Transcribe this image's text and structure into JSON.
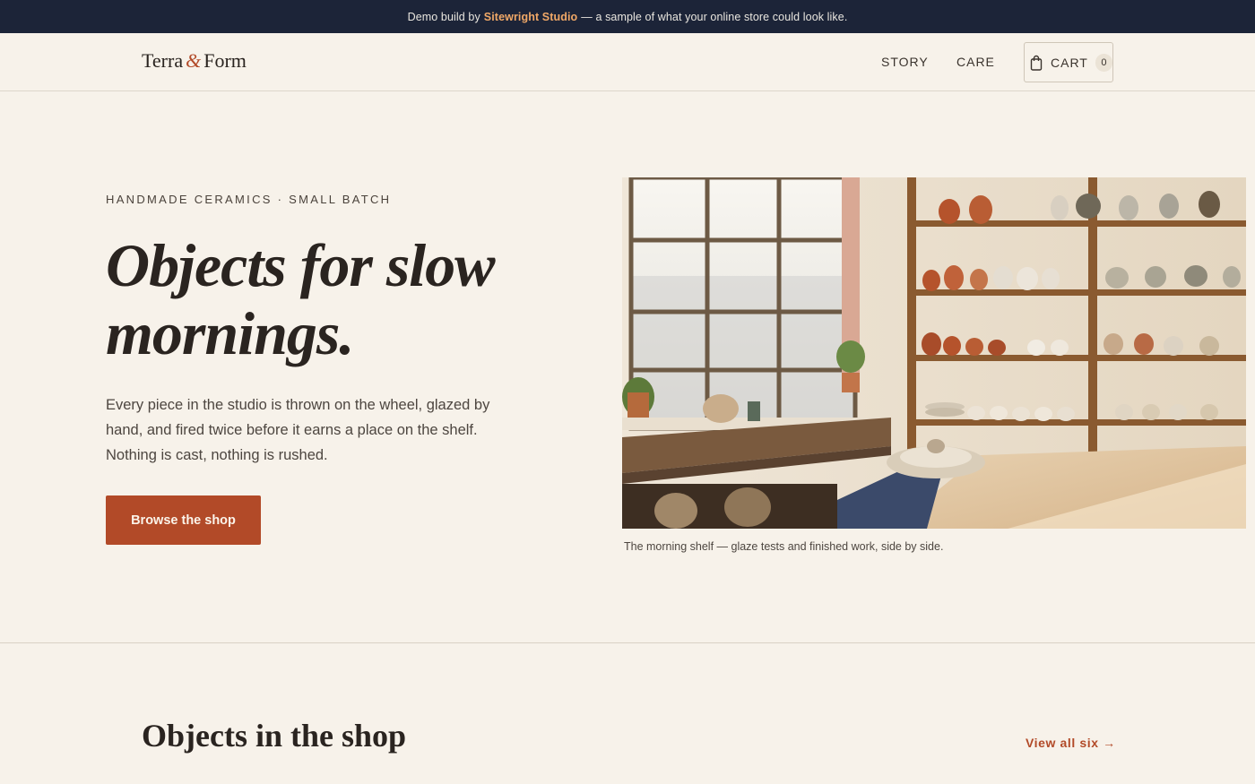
{
  "announcement": {
    "prefix": "Demo build by",
    "brand": "Sitewright Studio",
    "suffix": "— a sample of what your online store could look like."
  },
  "header": {
    "logo_left": "Terra",
    "logo_amp": "&",
    "logo_right": "Form",
    "nav": [
      {
        "label": "STORY"
      },
      {
        "label": "CARE"
      }
    ],
    "cart": {
      "label": "CART",
      "count": "0",
      "icon": "shopping-bag-icon"
    }
  },
  "hero": {
    "eyebrow": "HANDMADE CERAMICS · SMALL BATCH",
    "title": "Objects for slow mornings.",
    "body": "Every piece in the studio is thrown on the wheel, glazed by hand, and fired twice before it earns a place on the shelf. Nothing is cast, nothing is rushed.",
    "cta_label": "Browse the shop",
    "image_caption": "The morning shelf — glaze tests and finished work, side by side."
  },
  "shop": {
    "title": "Objects in the shop",
    "view_all": "View all six →"
  },
  "colors": {
    "background": "#f7f2ea",
    "announcement_bg": "#1c2438",
    "accent": "#b24a28",
    "brand_highlight": "#f0a867"
  }
}
